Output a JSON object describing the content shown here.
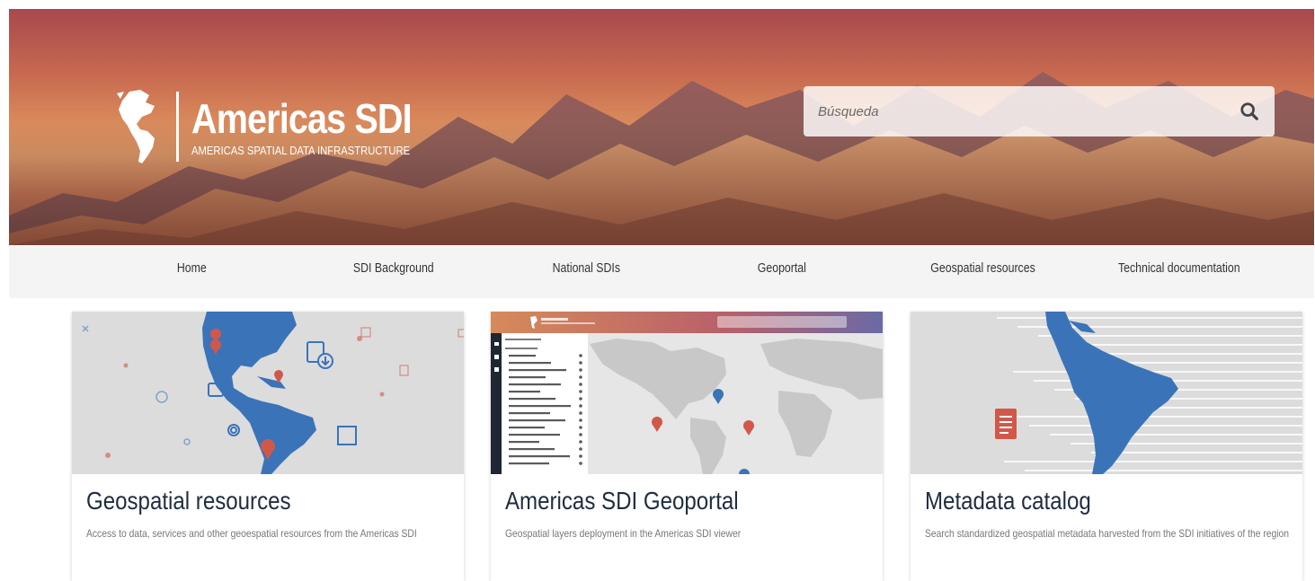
{
  "header": {
    "logo_title": "Americas SDI",
    "logo_subtitle": "AMERICAS SPATIAL DATA INFRASTRUCTURE",
    "search_placeholder": "Búsqueda"
  },
  "nav": [
    {
      "label": "Home"
    },
    {
      "label": "SDI Background"
    },
    {
      "label": "National SDIs"
    },
    {
      "label": "Geoportal"
    },
    {
      "label": "Geospatial resources"
    },
    {
      "label": "Technical documentation"
    }
  ],
  "cards": [
    {
      "title": "Geospatial resources",
      "description": "Access to data, services and other geoespatial resources from the Americas SDI"
    },
    {
      "title": "Americas SDI Geoportal",
      "description": "Geospatial layers deployment in the Americas SDI viewer"
    },
    {
      "title": "Metadata catalog",
      "description": "Search standardized geospatial metadata harvested from the SDI initiatives of the region"
    }
  ],
  "colors": {
    "map_blue": "#3b73b9",
    "pin_red": "#d0584a",
    "nav_bg": "#f4f4f4",
    "title_dark": "#1e2d40"
  },
  "icons": {
    "search": "search-icon",
    "logo": "americas-globe-icon"
  }
}
